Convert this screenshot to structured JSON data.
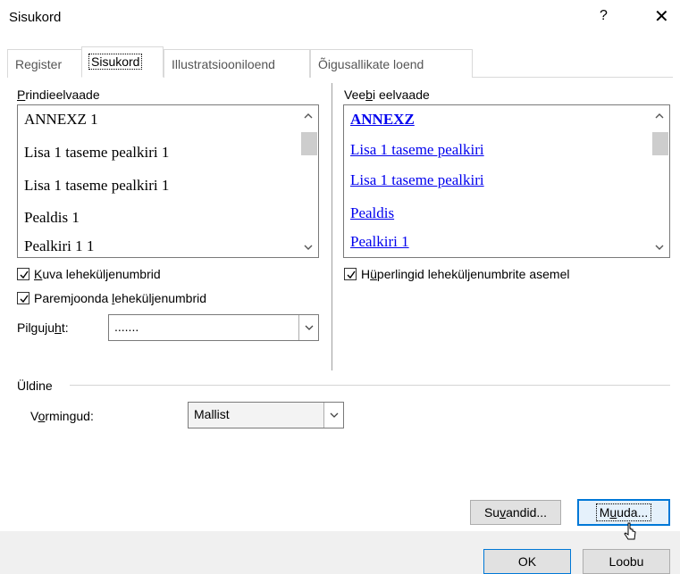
{
  "window": {
    "title": "Sisukord",
    "help": "?",
    "close": "✕"
  },
  "tabs": [
    {
      "label": "Register",
      "active": false
    },
    {
      "label": "Sisukord",
      "active": true
    },
    {
      "label": "Illustratsiooniloend",
      "active": false
    },
    {
      "label": "Õigusallikate loend",
      "active": false
    }
  ],
  "print_preview": {
    "label_pre": "",
    "label_u": "P",
    "label_post": "rindieelvaade",
    "items": [
      "ANNEXZ 1",
      "Lisa 1 taseme pealkiri 1",
      "Lisa 1 taseme pealkiri 1",
      "Pealdis 1",
      "Pealkiri 1 1"
    ]
  },
  "web_preview": {
    "label_pre": "Vee",
    "label_u": "b",
    "label_post": "i eelvaade",
    "items": [
      "ANNEXZ",
      "Lisa 1 taseme pealkiri",
      "Lisa 1 taseme pealkiri",
      "Pealdis",
      "Pealkiri 1"
    ]
  },
  "options": {
    "show_page_numbers": {
      "pre": "",
      "u": "K",
      "post": "uva leheküljenumbrid",
      "checked": true
    },
    "right_align": {
      "pre": "Paremjoonda ",
      "u": "l",
      "post": "eheküljenumbrid",
      "checked": true
    },
    "tab_leader": {
      "pre": "Pilguju",
      "u": "h",
      "post": "t:",
      "value": "......."
    },
    "hyperlinks": {
      "pre": "H",
      "u": "ü",
      "post": "perlingid leheküljenumbrite asemel",
      "checked": true
    }
  },
  "general": {
    "title": "Üldine",
    "formats": {
      "pre": "V",
      "u": "o",
      "post": "rmingud:",
      "value": "Mallist"
    }
  },
  "buttons": {
    "options": {
      "pre": "Su",
      "u": "v",
      "post": "andid..."
    },
    "modify": {
      "pre": "M",
      "u": "u",
      "post": "uda..."
    },
    "ok": "OK",
    "cancel": "Loobu"
  }
}
